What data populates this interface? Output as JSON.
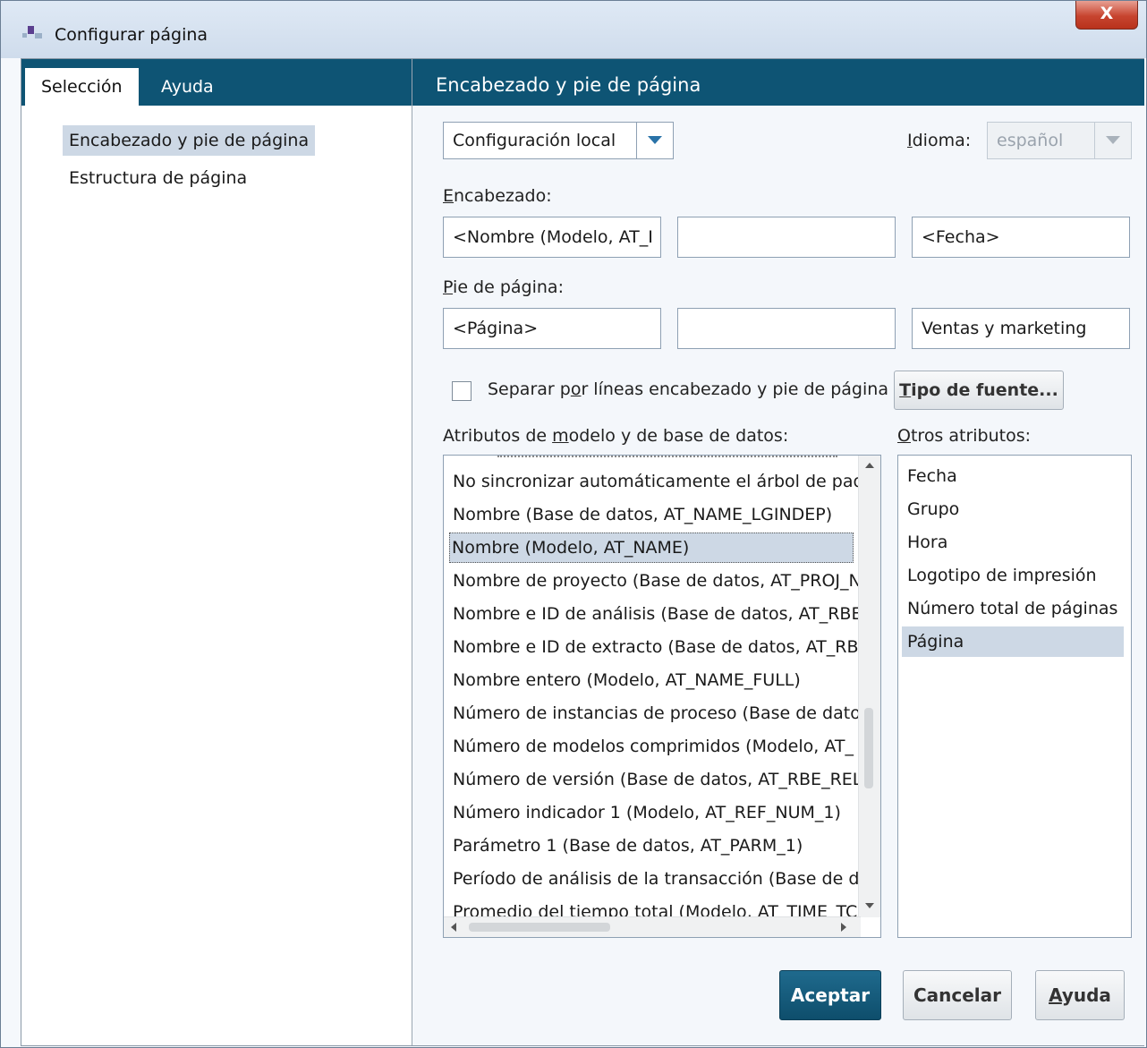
{
  "window": {
    "title": "Configurar página",
    "close_label": "X"
  },
  "left_pane": {
    "tabs": [
      {
        "label": "Selección"
      },
      {
        "label": "Ayuda"
      }
    ],
    "nav_items": [
      {
        "label": "Encabezado y pie de página"
      },
      {
        "label": "Estructura de página"
      }
    ]
  },
  "right_pane": {
    "header": "Encabezado y pie de página",
    "settings_combo": {
      "value": "Configuración local"
    },
    "language": {
      "label_pre": "",
      "label_ul": "I",
      "label_post": "dioma:",
      "value": "español"
    },
    "header_section": {
      "label_ul": "E",
      "label_post": "ncabezado:",
      "left": "<Nombre (Modelo, AT_I",
      "center": "",
      "right": "<Fecha>"
    },
    "footer_section": {
      "label_ul": "P",
      "label_post": "ie de página:",
      "left": "<Página>",
      "center": "",
      "right": "Ventas y marketing"
    },
    "separator_checkbox": {
      "label_pre": "Separar p",
      "label_ul": "o",
      "label_post": "r líneas encabezado y pie de página"
    },
    "font_button": {
      "label_ul": "T",
      "label_post": "ipo de fuente..."
    },
    "attr_list": {
      "label_pre": "Atributos de ",
      "label_ul": "m",
      "label_post": "odelo y de base de datos:",
      "items": [
        "No sincronizar automáticamente el árbol de paqu",
        "Nombre (Base de datos, AT_NAME_LGINDEP)",
        "Nombre (Modelo, AT_NAME)",
        "Nombre de proyecto (Base de datos, AT_PROJ_N.",
        "Nombre e ID de análisis (Base de datos, AT_RBE_A",
        "Nombre e ID de extracto (Base de datos, AT_RBE_",
        "Nombre entero (Modelo, AT_NAME_FULL)",
        "Número de instancias de proceso (Base de datos,",
        "Número de modelos comprimidos (Modelo, AT_",
        "Número de versión (Base de datos, AT_RBE_REL)",
        "Número indicador 1 (Modelo, AT_REF_NUM_1)",
        "Parámetro 1 (Base de datos, AT_PARM_1)",
        "Período de análisis de la transacción (Base de dat",
        "Promedio del tiempo total (Modelo, AT_TIME_TC"
      ],
      "selected": "Nombre (Modelo, AT_NAME)"
    },
    "other_list": {
      "label_ul": "O",
      "label_post": "tros atributos:",
      "items": [
        "Fecha",
        "Grupo",
        "Hora",
        "Logotipo de impresión",
        "Número total de páginas",
        "Página"
      ],
      "selected": "Página"
    },
    "buttons": {
      "ok": "Aceptar",
      "cancel": "Cancelar",
      "help_ul": "A",
      "help_post": "yuda"
    }
  },
  "colors": {
    "accent_header": "#0e5474",
    "selection": "#cdd8e5",
    "primary_button": "#175f80"
  }
}
